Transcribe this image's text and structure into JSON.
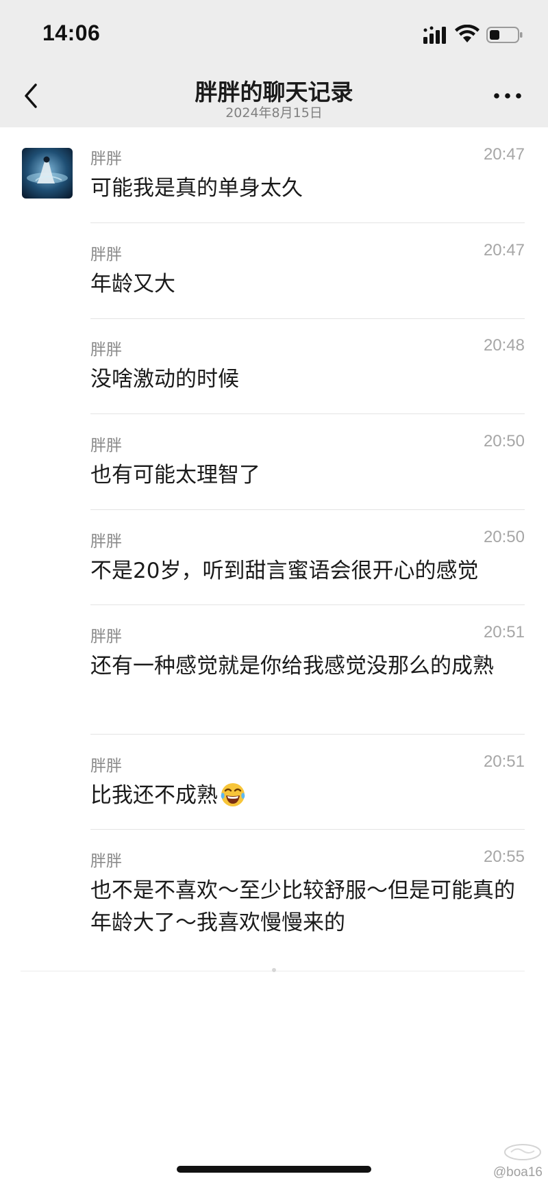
{
  "status_bar": {
    "time": "14:06",
    "icons": [
      "cellular-signal-icon",
      "wifi-icon",
      "battery-icon"
    ]
  },
  "nav": {
    "title": "胖胖的聊天记录",
    "subtitle": "2024年8月15日",
    "back_icon": "chevron-left-icon",
    "more_icon": "more-dots-icon"
  },
  "messages": [
    {
      "sender": "胖胖",
      "time": "20:47",
      "text": "可能我是真的单身太久"
    },
    {
      "sender": "胖胖",
      "time": "20:47",
      "text": "年龄又大"
    },
    {
      "sender": "胖胖",
      "time": "20:48",
      "text": "没啥激动的时候"
    },
    {
      "sender": "胖胖",
      "time": "20:50",
      "text": "也有可能太理智了"
    },
    {
      "sender": "胖胖",
      "time": "20:50",
      "text": "不是20岁，听到甜言蜜语会很开心的感觉"
    },
    {
      "sender": "胖胖",
      "time": "20:51",
      "text": "还有一种感觉就是你给我感觉没那么的成熟"
    },
    {
      "sender": "胖胖",
      "time": "20:51",
      "text": "比我还不成熟",
      "emoji": "tears-of-joy-emoji"
    },
    {
      "sender": "胖胖",
      "time": "20:55",
      "text": "也不是不喜欢～至少比较舒服～但是可能真的年龄大了～我喜欢慢慢来的"
    }
  ],
  "watermark": {
    "text": "@boa16"
  },
  "colors": {
    "header_bg": "#ededed",
    "page_bg": "#ffffff",
    "meta_text": "#8a8a8a",
    "time_text": "#a6a6a6"
  }
}
